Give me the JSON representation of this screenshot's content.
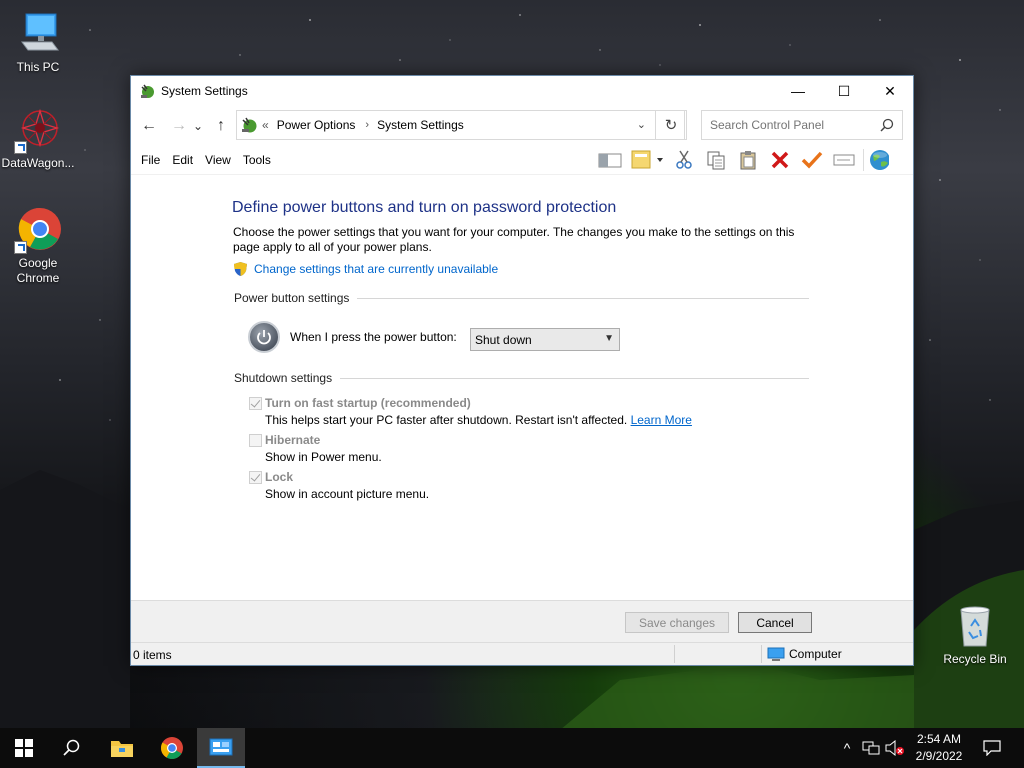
{
  "desktop": {
    "icons": [
      {
        "label": "This PC"
      },
      {
        "label": "DataWagon..."
      },
      {
        "label": "Google Chrome"
      },
      {
        "label": "Recycle Bin"
      }
    ]
  },
  "window": {
    "title": "System Settings",
    "controls": {
      "minimize": "—",
      "maximize": "☐",
      "close": "✕"
    },
    "nav": {
      "back": "←",
      "forward": "→",
      "recent": "⌄",
      "up": "↑",
      "breadcrumb_prefix": "«",
      "breadcrumbs": [
        "Power Options",
        "System Settings"
      ],
      "refresh": "↻",
      "search_placeholder": "Search Control Panel"
    },
    "menu": [
      "File",
      "Edit",
      "View",
      "Tools"
    ],
    "toolbar_icons": [
      "layout-icon",
      "properties-icon",
      "cut-icon",
      "copy-icon",
      "paste-icon",
      "delete-icon",
      "checkmark-icon",
      "rename-icon",
      "globe-icon"
    ]
  },
  "content": {
    "heading": "Define power buttons and turn on password protection",
    "description": "Choose the power settings that you want for your computer. The changes you make to the settings on this page apply to all of your power plans.",
    "change_link": "Change settings that are currently unavailable",
    "power_section": "Power button settings",
    "power_label": "When I press the power button:",
    "power_value": "Shut down",
    "shutdown_section": "Shutdown settings",
    "options": [
      {
        "title": "Turn on fast startup (recommended)",
        "sub": "This helps start your PC faster after shutdown. Restart isn't affected.",
        "link": "Learn More",
        "checked": true
      },
      {
        "title": "Hibernate",
        "sub": "Show in Power menu.",
        "checked": false
      },
      {
        "title": "Lock",
        "sub": "Show in account picture menu.",
        "checked": true
      }
    ]
  },
  "footer": {
    "save": "Save changes",
    "cancel": "Cancel"
  },
  "status": {
    "items": "0 items",
    "location": "Computer"
  },
  "taskbar": {
    "time": "2:54 AM",
    "date": "2/9/2022",
    "tray_chevron": "^"
  },
  "colors": {
    "link": "#0066cc",
    "heading": "#1e3287",
    "accent": "#76b9ed"
  }
}
